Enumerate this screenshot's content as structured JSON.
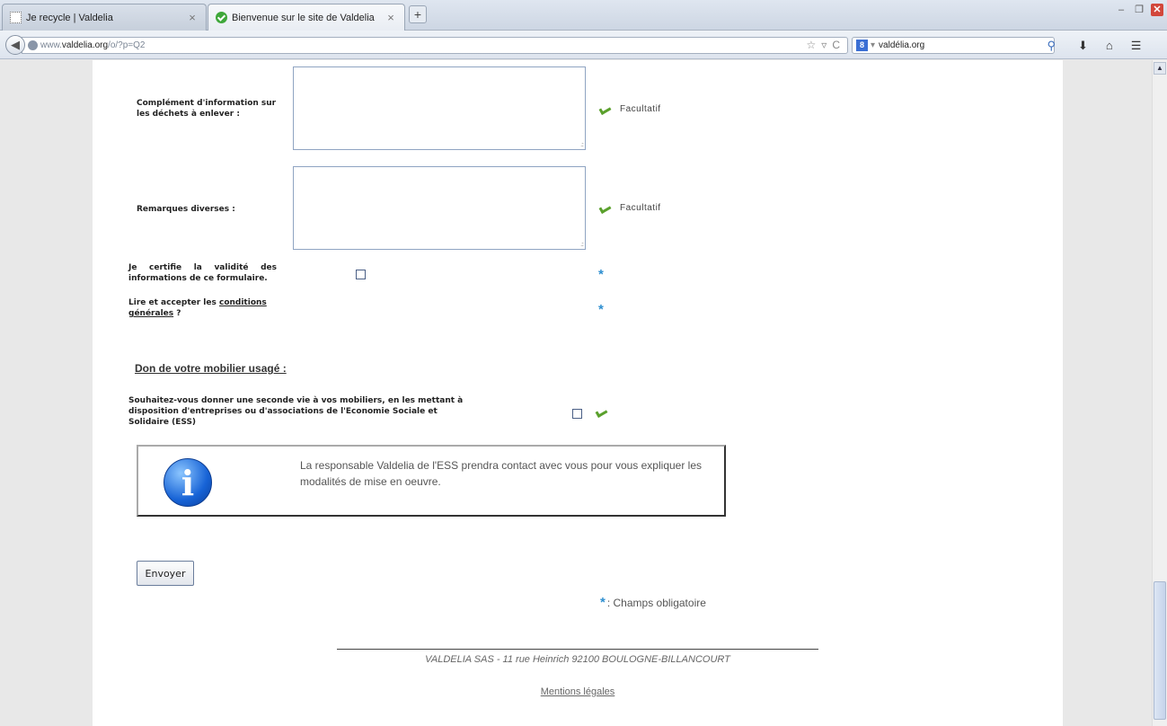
{
  "browser": {
    "tabs": [
      {
        "label": "Je recycle | Valdelia",
        "close": "×"
      },
      {
        "label": "Bienvenue sur le site de Valdelia",
        "close": "×"
      }
    ],
    "new_tab": "+",
    "url": {
      "host_dim": "www.",
      "host": "valdelia.org",
      "path": "/o/?p=Q2"
    },
    "search": {
      "engine": "8",
      "value": "valdélia.org"
    }
  },
  "form": {
    "fields": [
      {
        "label": "Complément d'information sur les déchets à enlever :",
        "hint": "Facultatif"
      },
      {
        "label": "Remarques diverses :",
        "hint": "Facultatif"
      }
    ],
    "certify_label": "Je certifie la validité des informations de ce formulaire.",
    "conditions": {
      "prefix": "Lire et accepter les ",
      "link": "conditions générales",
      "suffix": " ?"
    },
    "section_title": "Don de votre mobilier usagé :",
    "donation_label": "Souhaitez-vous donner une seconde vie à vos mobiliers, en les mettant à disposition d'entreprises ou d'associations de l'Economie Sociale et Solidaire (ESS)",
    "info_text": "La responsable Valdelia de l'ESS prendra contact avec vous pour vous expliquer les modalités de mise en oeuvre.",
    "info_icon_letter": "i",
    "submit_label": "Envoyer",
    "required_star": "*",
    "legend": ": Champs obligatoire"
  },
  "footer": {
    "address": "VALDELIA SAS - 11 rue Heinrich 92100 BOULOGNE-BILLANCOURT",
    "legal_link": "Mentions légales"
  },
  "colors": {
    "accent_star": "#2f8fd0",
    "check": "#5aa02c"
  }
}
